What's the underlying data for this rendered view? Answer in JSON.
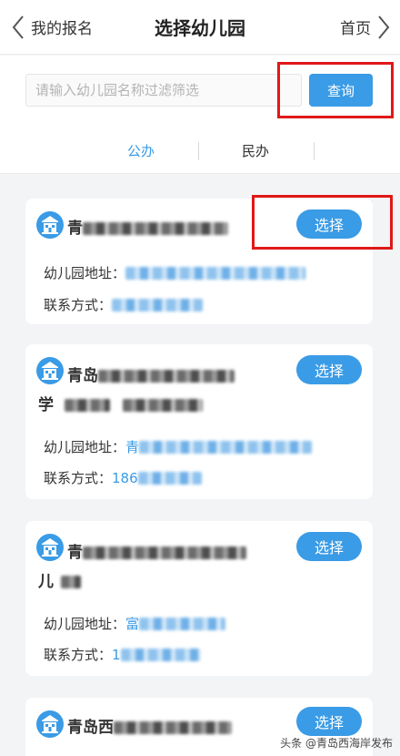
{
  "nav": {
    "back_label": "我的报名",
    "title": "选择幼儿园",
    "home_label": "首页"
  },
  "search": {
    "placeholder": "请输入幼儿园名称过滤筛选",
    "button_label": "查询"
  },
  "tabs": [
    {
      "label": "公办",
      "active": true
    },
    {
      "label": "民办",
      "active": false
    }
  ],
  "cards": [
    {
      "name_visible": "青",
      "name_line2": "",
      "address_label": "幼儿园地址：",
      "address_visible": "",
      "contact_label": "联系方式：",
      "contact_visible": "",
      "select_label": "选择"
    },
    {
      "name_visible": "青岛",
      "name_line2": "学",
      "address_label": "幼儿园地址：",
      "address_visible": "青",
      "contact_label": "联系方式：",
      "contact_visible": "186",
      "select_label": "选择"
    },
    {
      "name_visible": "青",
      "name_line2": "儿",
      "address_label": "幼儿园地址：",
      "address_visible": "富",
      "contact_label": "联系方式：",
      "contact_visible": "1",
      "select_label": "选择"
    },
    {
      "name_visible": "青岛西",
      "name_line2": "",
      "select_label": "选择"
    }
  ],
  "colors": {
    "accent": "#3a9be6",
    "highlight_box": "#e01818"
  },
  "watermark": "头条 @青岛西海岸发布"
}
